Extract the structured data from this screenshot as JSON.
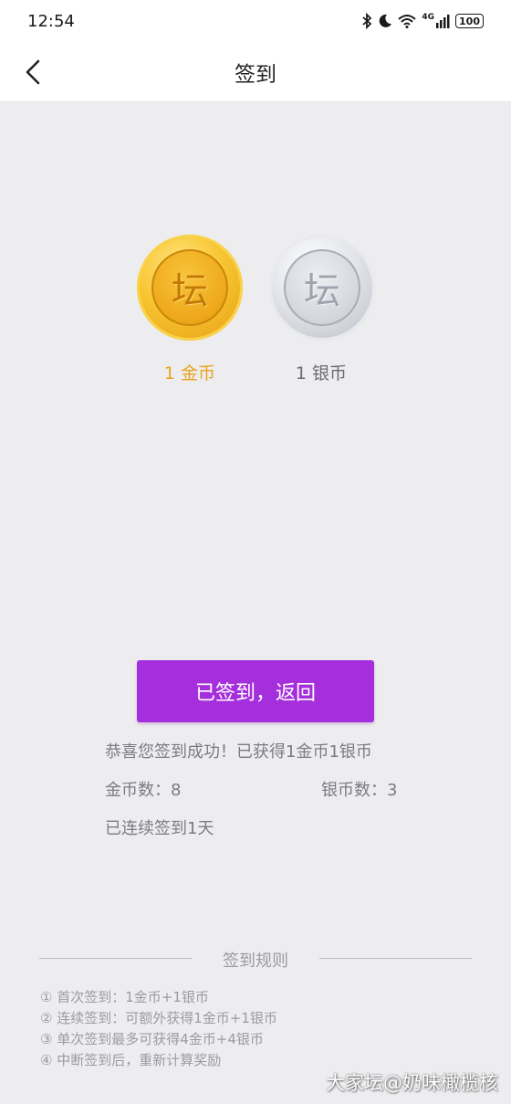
{
  "status_bar": {
    "time": "12:54",
    "network": "4G",
    "battery": "100"
  },
  "header": {
    "title": "签到"
  },
  "coins": {
    "gold": {
      "glyph": "坛",
      "label": "1 金币"
    },
    "silver": {
      "glyph": "坛",
      "label": "1 银币"
    }
  },
  "button": {
    "label": "已签到，返回"
  },
  "result": {
    "message": "恭喜您签到成功！已获得1金币1银币",
    "gold_count": "金币数：8",
    "silver_count": "银币数：3",
    "streak": "已连续签到1天"
  },
  "rules": {
    "title": "签到规则",
    "items": [
      "① 首次签到：1金币+1银币",
      "② 连续签到：可额外获得1金币+1银币",
      "③ 单次签到最多可获得4金币+4银币",
      "④ 中断签到后，重新计算奖励"
    ]
  },
  "watermark": "大家坛@奶味橄榄核",
  "colors": {
    "accent_purple": "#a52fdc",
    "gold_text": "#e9a21b",
    "background": "#ededf0"
  }
}
